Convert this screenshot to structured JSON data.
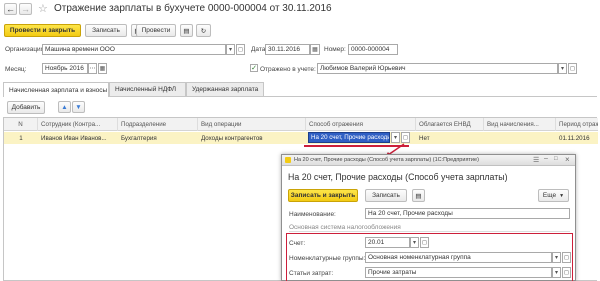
{
  "window": {
    "title": "Отражение зарплаты в бухучете 0000-000004 от 30.11.2016"
  },
  "toolbar": {
    "post_and_close": "Провести и закрыть",
    "write": "Записать",
    "post": "Провести"
  },
  "header": {
    "org_label": "Организация:",
    "org_value": "Машина времени ООО",
    "date_label": "Дата:",
    "date_value": "30.11.2016",
    "number_label": "Номер:",
    "number_value": "0000-000004",
    "month_label": "Месяц:",
    "month_value": "Ноябрь 2016",
    "reflected_label": "Отражено в учете:",
    "reflected_value": "Любимов Валерий Юрьевич"
  },
  "tabs": [
    {
      "label": "Начисленная зарплата и взносы",
      "active": true
    },
    {
      "label": "Начисленный НДФЛ",
      "active": false
    },
    {
      "label": "Удержанная зарплата",
      "active": false
    }
  ],
  "table_toolbar": {
    "add": "Добавить"
  },
  "table": {
    "columns": [
      "N",
      "Сотрудник (Контра...",
      "Подразделение",
      "Вид операции",
      "Способ отражения",
      "Облагается ЕНВД",
      "Вид начисления...",
      "Период отраж..."
    ],
    "rows": [
      {
        "n": "1",
        "employee": "Иванов Иван Иванов...",
        "department": "Бухгалтерия",
        "operation": "Доходы контрагентов",
        "method": "На 20 счет, Прочие расходы",
        "envd": "Нет",
        "accrual_type": "",
        "period": "01.11.2016"
      }
    ]
  },
  "popup": {
    "title": "На 20 счет, Прочие расходы (Способ учета зарплаты) (1С:Предприятие)",
    "heading": "На 20 счет, Прочие расходы (Способ учета зарплаты)",
    "save_close": "Записать и закрыть",
    "write": "Записать",
    "more": "Еще",
    "name_label": "Наименование:",
    "name_value": "На 20 счет, Прочие расходы",
    "tax_system": "Основная система налогообложения",
    "account_label": "Счет:",
    "account_value": "20.01",
    "nomenclature_label": "Номенклатурные группы:",
    "nomenclature_value": "Основная номенклатурная группа",
    "costs_label": "Статьи затрат:",
    "costs_value": "Прочие затраты"
  },
  "colors": {
    "accent_yellow": "#f3cb14",
    "selected_row": "#fbf3c4",
    "highlight_red": "#cc1f3a",
    "cell_blue": "#2f5fc4"
  }
}
